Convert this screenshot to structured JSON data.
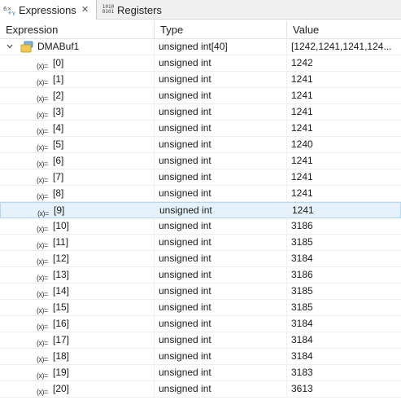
{
  "tabs": [
    {
      "label": "Expressions",
      "active": true,
      "icon": "expressions-icon",
      "close": "✕"
    },
    {
      "label": "Registers",
      "active": false,
      "icon": "registers-binary-icon",
      "icon_text": [
        "1010",
        "0101"
      ]
    }
  ],
  "columns": {
    "expression": "Expression",
    "type": "Type",
    "value": "Value"
  },
  "root": {
    "name": "DMABuf1",
    "type": "unsigned int[40]",
    "value": "[1242,1241,1241,124...",
    "expanded": true
  },
  "var_icon_text": "(x)=",
  "selected_index": 9,
  "elements": [
    {
      "name": "[0]",
      "type": "unsigned int",
      "value": "1242"
    },
    {
      "name": "[1]",
      "type": "unsigned int",
      "value": "1241"
    },
    {
      "name": "[2]",
      "type": "unsigned int",
      "value": "1241"
    },
    {
      "name": "[3]",
      "type": "unsigned int",
      "value": "1241"
    },
    {
      "name": "[4]",
      "type": "unsigned int",
      "value": "1241"
    },
    {
      "name": "[5]",
      "type": "unsigned int",
      "value": "1240"
    },
    {
      "name": "[6]",
      "type": "unsigned int",
      "value": "1241"
    },
    {
      "name": "[7]",
      "type": "unsigned int",
      "value": "1241"
    },
    {
      "name": "[8]",
      "type": "unsigned int",
      "value": "1241"
    },
    {
      "name": "[9]",
      "type": "unsigned int",
      "value": "1241"
    },
    {
      "name": "[10]",
      "type": "unsigned int",
      "value": "3186"
    },
    {
      "name": "[11]",
      "type": "unsigned int",
      "value": "3185"
    },
    {
      "name": "[12]",
      "type": "unsigned int",
      "value": "3184"
    },
    {
      "name": "[13]",
      "type": "unsigned int",
      "value": "3186"
    },
    {
      "name": "[14]",
      "type": "unsigned int",
      "value": "3185"
    },
    {
      "name": "[15]",
      "type": "unsigned int",
      "value": "3185"
    },
    {
      "name": "[16]",
      "type": "unsigned int",
      "value": "3184"
    },
    {
      "name": "[17]",
      "type": "unsigned int",
      "value": "3184"
    },
    {
      "name": "[18]",
      "type": "unsigned int",
      "value": "3184"
    },
    {
      "name": "[19]",
      "type": "unsigned int",
      "value": "3183"
    },
    {
      "name": "[20]",
      "type": "unsigned int",
      "value": "3613"
    }
  ],
  "colors": {
    "selected_bg": "#e5f1fb",
    "selected_border": "#b6d7f4",
    "grid": "#eeeeee"
  }
}
